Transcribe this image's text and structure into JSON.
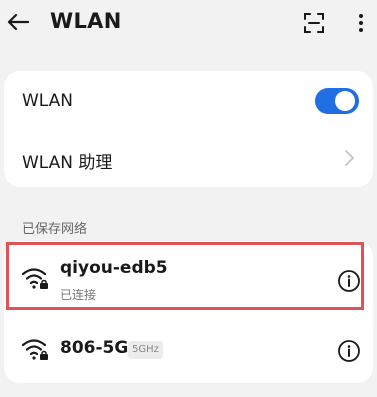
{
  "header": {
    "title": "WLAN",
    "back_icon": "arrow-left-icon",
    "scan_icon": "scan-frame-icon",
    "more_icon": "more-vertical-icon"
  },
  "settings": {
    "wlan_label": "WLAN",
    "wlan_enabled": true,
    "assistant_label": "WLAN 助理"
  },
  "saved_networks": {
    "section_title": "已保存网络",
    "items": [
      {
        "ssid": "qiyou-edb5",
        "status": "已连接",
        "band": "",
        "secured": true,
        "selected": true
      },
      {
        "ssid": "806-5G",
        "status": "",
        "band": "5GHz",
        "secured": true,
        "selected": false
      }
    ]
  },
  "colors": {
    "accent": "#1f6fe3",
    "highlight": "#e05257",
    "background": "#f2f2f2",
    "card": "#ffffff"
  }
}
